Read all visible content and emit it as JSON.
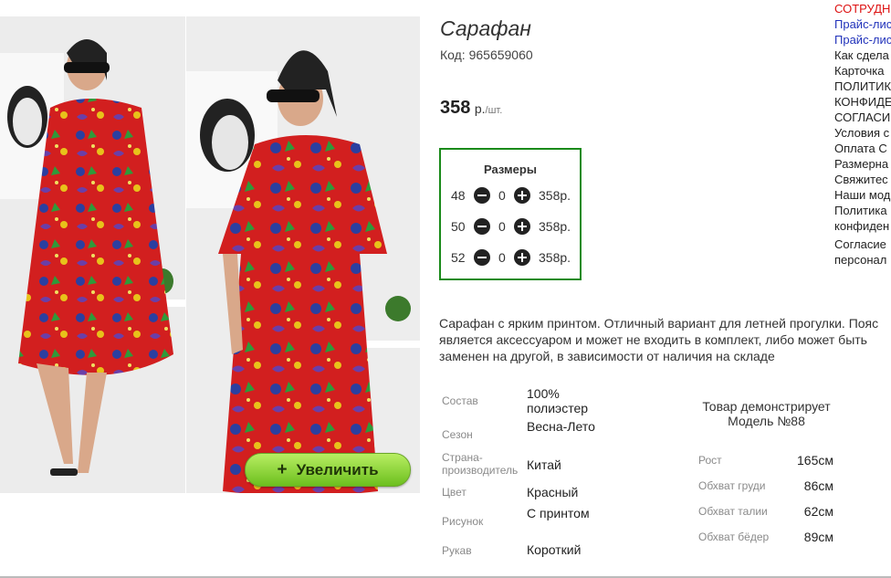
{
  "product": {
    "title": "Сарафан",
    "code": "Код: 965659060",
    "price_value": "358",
    "price_unit": "р.",
    "price_per": "/шт."
  },
  "zoom": {
    "label": "Увеличить",
    "icon": "plus-icon"
  },
  "sizes": {
    "title": "Размеры",
    "rows": [
      {
        "size": "48",
        "qty": "0",
        "price": "358р."
      },
      {
        "size": "50",
        "qty": "0",
        "price": "358р."
      },
      {
        "size": "52",
        "qty": "0",
        "price": "358р."
      }
    ]
  },
  "description": "Сарафан с ярким принтом. Отличный вариант для летней прогулки. Пояс является аксессуаром и может не входить в комплект, либо может быть заменен на другой, в зависимости от наличия на складе",
  "properties": [
    {
      "label": "Состав",
      "value": "100% полиэстер"
    },
    {
      "label": "Сезон",
      "value": "Весна-Лето"
    },
    {
      "label": "Страна-производитель",
      "value": "Китай"
    },
    {
      "label": "Цвет",
      "value": "Красный"
    },
    {
      "label": "Рисунок",
      "value": "С принтом"
    },
    {
      "label": "Рукав",
      "value": "Короткий"
    }
  ],
  "model": {
    "title": "Товар демонстрирует Модель №88",
    "measurements": [
      {
        "label": "Рост",
        "value": "165см"
      },
      {
        "label": "Обхват груди",
        "value": "86см"
      },
      {
        "label": "Обхват талии",
        "value": "62см"
      },
      {
        "label": "Обхват бёдер",
        "value": "89см"
      }
    ]
  },
  "side_menu": [
    "СОТРУДН",
    "Прайс-лис",
    "Прайс-лис",
    "Как сдела",
    "Карточка",
    "ПОЛИТИКА",
    "КОНФИДЕ",
    "СОГЛАСИ",
    "Условия с",
    "Оплата С",
    "Размерна",
    "Свяжитес",
    "Наши мод",
    "Политика",
    "конфиден",
    "Согласие",
    "персонал"
  ],
  "colors": {
    "dress": "#d21f1f",
    "frame_green": "#1a8a1a",
    "button_green": "#8ad43a",
    "link_blue": "#2233bb",
    "accent_red": "#dd1111"
  }
}
